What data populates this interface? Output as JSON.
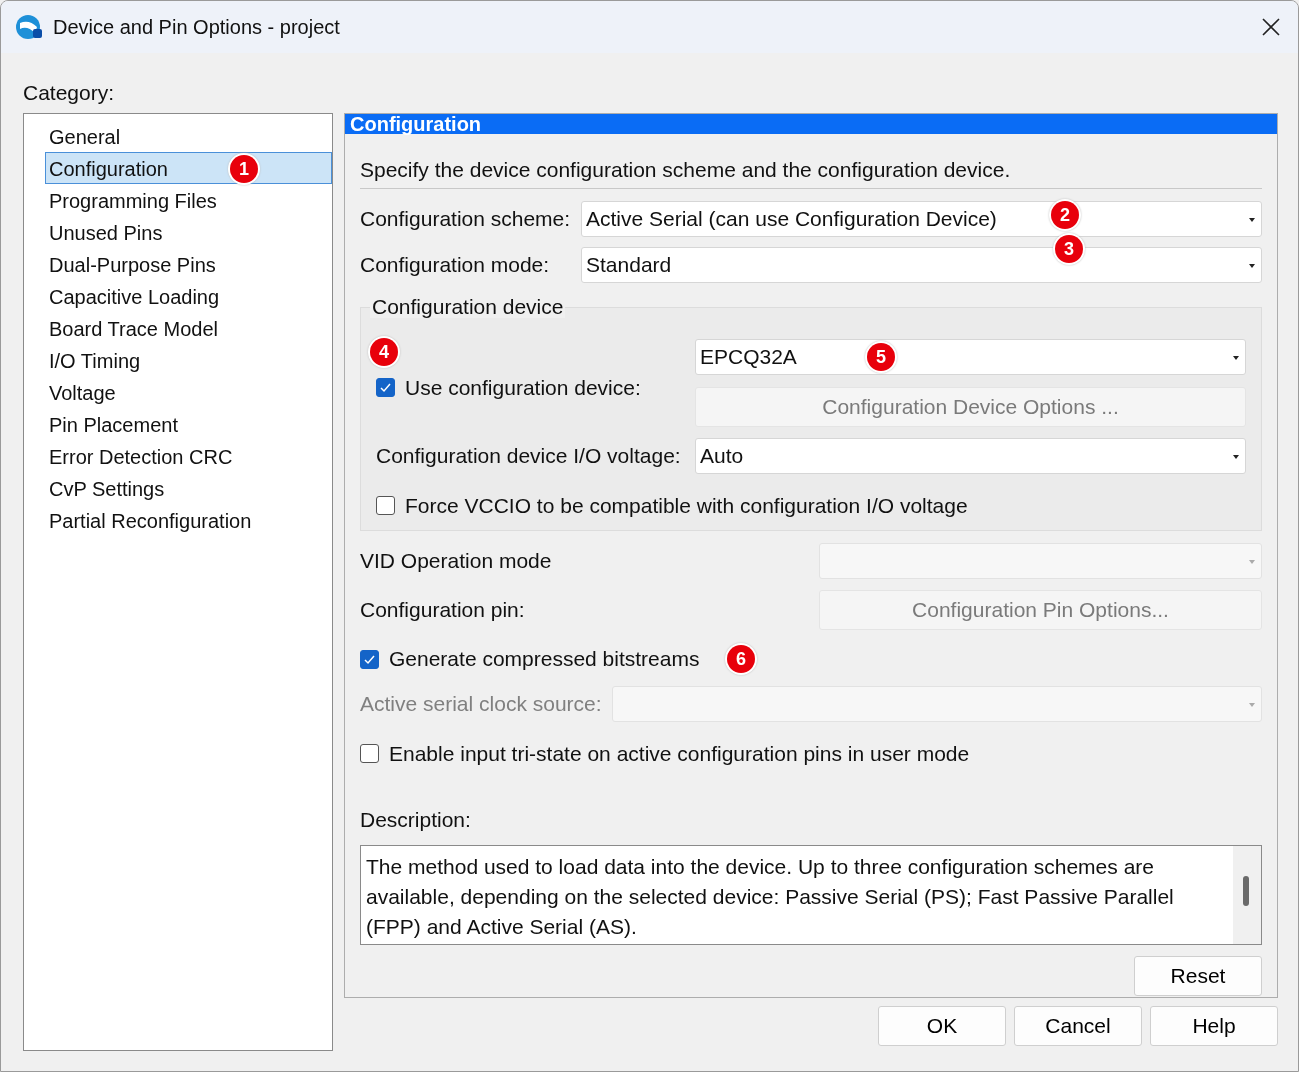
{
  "window": {
    "title": "Device and Pin Options - project"
  },
  "category_label": "Category:",
  "categories": [
    {
      "label": "General",
      "selected": false
    },
    {
      "label": "Configuration",
      "selected": true,
      "marker": "1"
    },
    {
      "label": "Programming Files",
      "selected": false
    },
    {
      "label": "Unused Pins",
      "selected": false
    },
    {
      "label": "Dual-Purpose Pins",
      "selected": false
    },
    {
      "label": "Capacitive Loading",
      "selected": false
    },
    {
      "label": "Board Trace Model",
      "selected": false
    },
    {
      "label": "I/O Timing",
      "selected": false
    },
    {
      "label": "Voltage",
      "selected": false
    },
    {
      "label": "Pin Placement",
      "selected": false
    },
    {
      "label": "Error Detection CRC",
      "selected": false
    },
    {
      "label": "CvP Settings",
      "selected": false
    },
    {
      "label": "Partial Reconfiguration",
      "selected": false
    }
  ],
  "panel": {
    "title": "Configuration",
    "intro": "Specify the device configuration scheme and the configuration device.",
    "fields": [
      {
        "label": "Configuration scheme:",
        "value": "Active Serial (can use Configuration Device)",
        "marker": "2"
      },
      {
        "label": "Configuration mode:",
        "value": "Standard",
        "marker": "3"
      }
    ],
    "device_group": {
      "legend": "Configuration device",
      "marker": "4",
      "use_checkbox": {
        "label": "Use configuration device:",
        "checked": true
      },
      "device_select": {
        "value": "EPCQ32A",
        "marker": "5"
      },
      "options_button": {
        "label": "Configuration Device Options ...",
        "disabled": true
      },
      "voltage": {
        "label": "Configuration device I/O voltage:",
        "value": "Auto"
      },
      "force_checkbox": {
        "label": "Force VCCIO to be compatible with configuration I/O voltage",
        "checked": false
      }
    },
    "vid": {
      "label": "VID Operation mode",
      "disabled": true
    },
    "config_pin": {
      "label": "Configuration pin:",
      "button": "Configuration Pin Options...",
      "disabled": true
    },
    "compress": {
      "label": "Generate compressed bitstreams",
      "checked": true,
      "marker": "6"
    },
    "clock_source": {
      "label": "Active serial clock source:",
      "disabled": true
    },
    "tristate": {
      "label": "Enable input tri-state on active configuration pins in user mode",
      "checked": false
    },
    "description_label": "Description:",
    "description": "The method used to load data into the device. Up to three configuration schemes are available, depending on the selected device: Passive Serial (PS); Fast Passive Parallel (FPP) and Active Serial (AS).",
    "reset": "Reset"
  },
  "buttons": [
    "OK",
    "Cancel",
    "Help"
  ]
}
